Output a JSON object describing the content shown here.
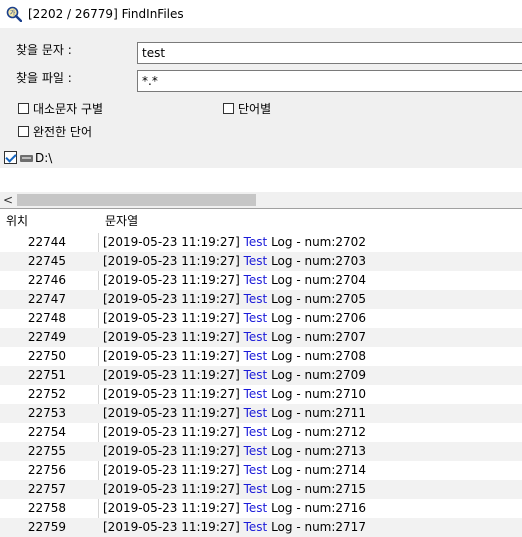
{
  "window": {
    "title": "[2202 / 26779] FindInFiles",
    "icon": "search-icon"
  },
  "search": {
    "find_label": "찾을 문자 :",
    "find_value": "test",
    "file_label": "찾을 파일 :",
    "file_value": "*.*",
    "options": {
      "match_case": {
        "label": "대소문자 구별",
        "checked": false
      },
      "word": {
        "label": "단어별",
        "checked": false
      },
      "whole_word": {
        "label": "완전한 단어",
        "checked": false
      }
    }
  },
  "drive": {
    "label": "D:\\",
    "checked": true,
    "icon": "drive-icon"
  },
  "scrollbar": {
    "left_arrow": "<"
  },
  "results": {
    "col_pos": "위치",
    "col_str": "문자열",
    "rows": [
      {
        "pos": "22744",
        "ts": "[2019-05-23 11:19:27] ",
        "kw": "Test",
        "rest": " Log - num:2702"
      },
      {
        "pos": "22745",
        "ts": "[2019-05-23 11:19:27] ",
        "kw": "Test",
        "rest": " Log - num:2703"
      },
      {
        "pos": "22746",
        "ts": "[2019-05-23 11:19:27] ",
        "kw": "Test",
        "rest": " Log - num:2704"
      },
      {
        "pos": "22747",
        "ts": "[2019-05-23 11:19:27] ",
        "kw": "Test",
        "rest": " Log - num:2705"
      },
      {
        "pos": "22748",
        "ts": "[2019-05-23 11:19:27] ",
        "kw": "Test",
        "rest": " Log - num:2706"
      },
      {
        "pos": "22749",
        "ts": "[2019-05-23 11:19:27] ",
        "kw": "Test",
        "rest": " Log - num:2707"
      },
      {
        "pos": "22750",
        "ts": "[2019-05-23 11:19:27] ",
        "kw": "Test",
        "rest": " Log - num:2708"
      },
      {
        "pos": "22751",
        "ts": "[2019-05-23 11:19:27] ",
        "kw": "Test",
        "rest": " Log - num:2709"
      },
      {
        "pos": "22752",
        "ts": "[2019-05-23 11:19:27] ",
        "kw": "Test",
        "rest": " Log - num:2710"
      },
      {
        "pos": "22753",
        "ts": "[2019-05-23 11:19:27] ",
        "kw": "Test",
        "rest": " Log - num:2711"
      },
      {
        "pos": "22754",
        "ts": "[2019-05-23 11:19:27] ",
        "kw": "Test",
        "rest": " Log - num:2712"
      },
      {
        "pos": "22755",
        "ts": "[2019-05-23 11:19:27] ",
        "kw": "Test",
        "rest": " Log - num:2713"
      },
      {
        "pos": "22756",
        "ts": "[2019-05-23 11:19:27] ",
        "kw": "Test",
        "rest": " Log - num:2714"
      },
      {
        "pos": "22757",
        "ts": "[2019-05-23 11:19:27] ",
        "kw": "Test",
        "rest": " Log - num:2715"
      },
      {
        "pos": "22758",
        "ts": "[2019-05-23 11:19:27] ",
        "kw": "Test",
        "rest": " Log - num:2716"
      },
      {
        "pos": "22759",
        "ts": "[2019-05-23 11:19:27] ",
        "kw": "Test",
        "rest": " Log - num:2717"
      }
    ]
  },
  "colors": {
    "keyword": "#1b1bd9",
    "panel_bg": "#f0f0f0",
    "row_stripe": "#f2f2f2"
  }
}
